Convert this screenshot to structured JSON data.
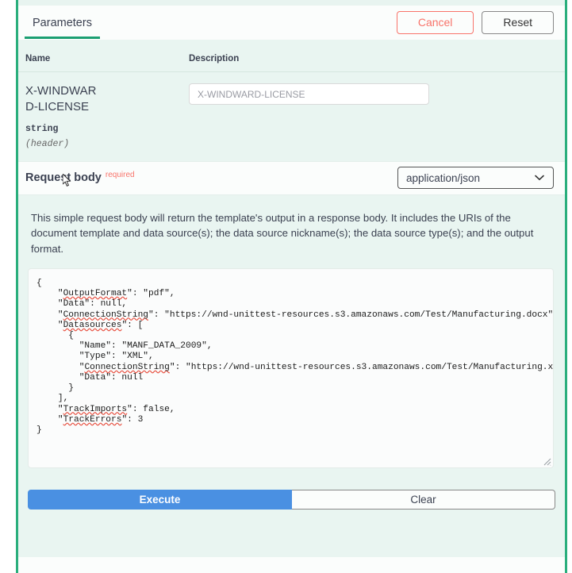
{
  "header": {
    "tabs": [
      {
        "label": "Parameters",
        "active": true
      }
    ],
    "cancel_label": "Cancel",
    "reset_label": "Reset",
    "accent_green": "#1b9f72",
    "cancel_color": "#f8736a"
  },
  "parameters": {
    "columns": {
      "name": "Name",
      "description": "Description"
    },
    "rows": [
      {
        "name": "X-WINDWARD-LICENSE",
        "type": "string",
        "location": "(header)",
        "input_value": "",
        "input_placeholder": "X-WINDWARD-LICENSE"
      }
    ]
  },
  "request_body": {
    "title": "Request body",
    "required_label": "required",
    "content_type_selected": "application/json",
    "content_type_options": [
      "application/json"
    ],
    "description": "This simple request body will return the template's output in a response body. It includes the URIs of the document template and data source(s); the data source nickname(s); the data source type(s); and the output format.",
    "json_value": "{\n    \"OutputFormat\": \"pdf\",\n    \"Data\": null,\n    \"ConnectionString\": \"https://wnd-unittest-resources.s3.amazonaws.com/Test/Manufacturing.docx\",\n    \"Datasources\": [\n      {\n        \"Name\": \"MANF_DATA_2009\",\n        \"Type\": \"XML\",\n        \"ConnectionString\": \"https://wnd-unittest-resources.s3.amazonaws.com/Test/Manufacturing.xml\",\n        \"Data\": null\n      }\n    ],\n    \"TrackImports\": false,\n    \"TrackErrors\": 3\n}",
    "misspelled_tokens": [
      "OutputFormat",
      "ConnectionString",
      "Datasources",
      "TrackImports",
      "TrackErrors"
    ]
  },
  "actions": {
    "execute_label": "Execute",
    "clear_label": "Clear",
    "execute_color": "#4a90e2"
  }
}
